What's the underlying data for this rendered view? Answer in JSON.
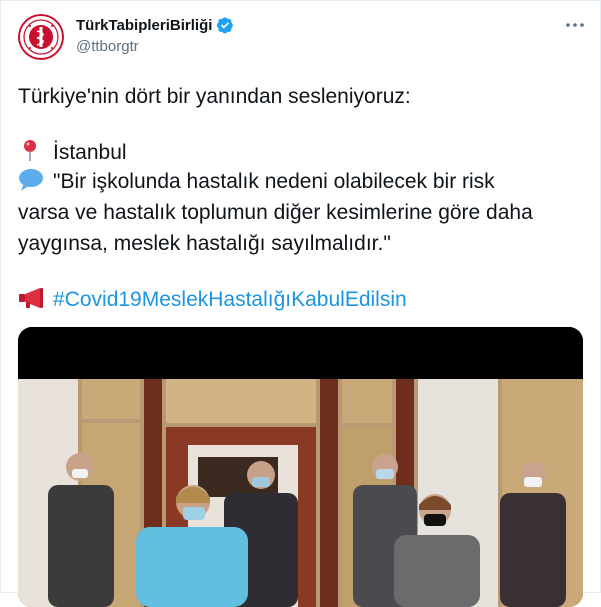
{
  "tweet": {
    "display_name": "TürkTabipleriBirliği",
    "handle": "@ttborgtr",
    "line_intro": "Türkiye'nin dört bir yanından sesleniyoruz:",
    "city": "İstanbul",
    "quote_line1": "\"Bir işkolunda hastalık nedeni olabilecek bir risk",
    "quote_line2": "varsa ve hastalık toplumun diğer kesimlerine göre daha",
    "quote_line3": "yaygınsa, meslek hastalığı sayılmalıdır.\"",
    "hashtag": "#Covid19MeslekHastalığıKabulEdilsin"
  },
  "icons": {
    "verified": "verified-badge-icon",
    "more": "more-options-icon",
    "pin": "round-pushpin-icon",
    "speech": "speech-balloon-icon",
    "megaphone": "megaphone-icon"
  },
  "colors": {
    "link": "#1b95e0",
    "verified": "#1da1f2",
    "secondary_text": "#5b7083",
    "logo_red": "#c8102e"
  }
}
